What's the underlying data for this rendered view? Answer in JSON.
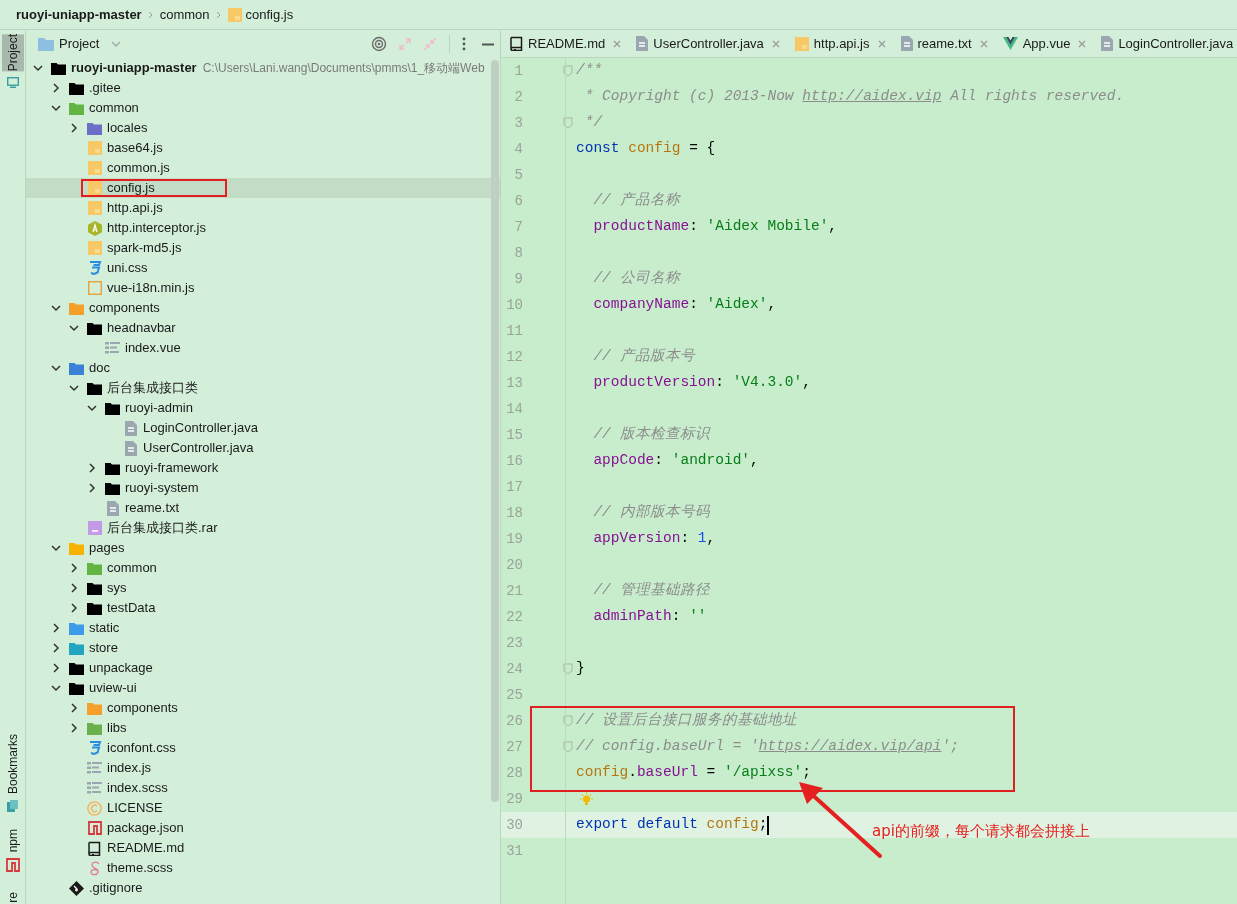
{
  "breadcrumb": [
    {
      "label": "ruoyi-uniapp-master",
      "kind": "project"
    },
    {
      "label": "common",
      "kind": "plain"
    },
    {
      "label": "config.js",
      "kind": "js"
    }
  ],
  "tool_strip": [
    {
      "label": "Project",
      "selected": true,
      "kind": "monitor"
    },
    {
      "label": "Bookmarks",
      "selected": false,
      "kind": "bookmark"
    },
    {
      "label": "npm",
      "selected": false,
      "kind": "npm"
    },
    {
      "label": "re",
      "selected": false,
      "kind": "plain"
    }
  ],
  "project_panel": {
    "title": "Project"
  },
  "tree": [
    {
      "label": "ruoyi-uniapp-master",
      "path": "C:\\Users\\Lani.wang\\Documents\\pmms\\1_移动端Web",
      "kind": "folder",
      "expanded": true,
      "selected": false,
      "children": [
        {
          "label": ".gitee",
          "kind": "folder",
          "expanded": false,
          "selected": false
        },
        {
          "label": "common",
          "kind": "folder-green",
          "expanded": true,
          "selected": false,
          "children": [
            {
              "label": "locales",
              "kind": "folder-purple",
              "expanded": false,
              "selected": false
            },
            {
              "label": "base64.js",
              "kind": "js",
              "selected": false
            },
            {
              "label": "common.js",
              "kind": "js",
              "selected": false
            },
            {
              "label": "config.js",
              "kind": "js",
              "selected": true,
              "marked": true
            },
            {
              "label": "http.api.js",
              "kind": "js",
              "selected": false
            },
            {
              "label": "http.interceptor.js",
              "kind": "angular",
              "selected": false
            },
            {
              "label": "spark-md5.js",
              "kind": "js",
              "selected": false
            },
            {
              "label": "uni.css",
              "kind": "css",
              "selected": false
            },
            {
              "label": "vue-i18n.min.js",
              "kind": "js-outline",
              "selected": false
            }
          ]
        },
        {
          "label": "components",
          "kind": "folder-orange",
          "expanded": true,
          "selected": false,
          "children": [
            {
              "label": "headnavbar",
              "kind": "folder",
              "expanded": true,
              "selected": false,
              "children": [
                {
                  "label": "index.vue",
                  "kind": "list",
                  "selected": false
                }
              ]
            }
          ]
        },
        {
          "label": "doc",
          "kind": "folder-blue",
          "expanded": true,
          "selected": false,
          "children": [
            {
              "label": "后台集成接口类",
              "kind": "folder",
              "expanded": true,
              "selected": false,
              "children": [
                {
                  "label": "ruoyi-admin",
                  "kind": "folder",
                  "expanded": true,
                  "selected": false,
                  "children": [
                    {
                      "label": "LoginController.java",
                      "kind": "text",
                      "selected": false
                    },
                    {
                      "label": "UserController.java",
                      "kind": "text",
                      "selected": false
                    }
                  ]
                },
                {
                  "label": "ruoyi-framework",
                  "kind": "folder",
                  "expanded": false,
                  "selected": false
                },
                {
                  "label": "ruoyi-system",
                  "kind": "folder",
                  "expanded": false,
                  "selected": false
                },
                {
                  "label": "reame.txt",
                  "kind": "text",
                  "selected": false
                }
              ]
            },
            {
              "label": "后台集成接口类.rar",
              "kind": "archive",
              "selected": false
            }
          ]
        },
        {
          "label": "pages",
          "kind": "folder-yellow",
          "expanded": true,
          "selected": false,
          "children": [
            {
              "label": "common",
              "kind": "folder-green",
              "expanded": false,
              "selected": false
            },
            {
              "label": "sys",
              "kind": "folder",
              "expanded": false,
              "selected": false
            },
            {
              "label": "testData",
              "kind": "folder",
              "expanded": false,
              "selected": false
            }
          ]
        },
        {
          "label": "static",
          "kind": "folder-web",
          "expanded": false,
          "selected": false
        },
        {
          "label": "store",
          "kind": "folder-teal",
          "expanded": false,
          "selected": false
        },
        {
          "label": "unpackage",
          "kind": "folder",
          "expanded": false,
          "selected": false
        },
        {
          "label": "uview-ui",
          "kind": "folder",
          "expanded": true,
          "selected": false,
          "children": [
            {
              "label": "components",
              "kind": "folder-orange",
              "expanded": false,
              "selected": false
            },
            {
              "label": "libs",
              "kind": "folder-libs",
              "expanded": false,
              "selected": false
            },
            {
              "label": "iconfont.css",
              "kind": "css",
              "selected": false
            },
            {
              "label": "index.js",
              "kind": "list",
              "selected": false
            },
            {
              "label": "index.scss",
              "kind": "list",
              "selected": false
            },
            {
              "label": "LICENSE",
              "kind": "license",
              "selected": false
            },
            {
              "label": "package.json",
              "kind": "npm",
              "selected": false
            },
            {
              "label": "README.md",
              "kind": "book",
              "selected": false
            },
            {
              "label": "theme.scss",
              "kind": "sass",
              "selected": false
            }
          ]
        },
        {
          "label": ".gitignore",
          "kind": "git",
          "selected": false
        }
      ]
    }
  ],
  "editor_tabs": [
    {
      "label": "README.md",
      "kind": "book",
      "closable": true
    },
    {
      "label": "UserController.java",
      "kind": "text",
      "closable": true
    },
    {
      "label": "http.api.js",
      "kind": "js",
      "closable": true
    },
    {
      "label": "reame.txt",
      "kind": "text",
      "closable": true
    },
    {
      "label": "App.vue",
      "kind": "vue",
      "closable": true
    },
    {
      "label": "LoginController.java",
      "kind": "text",
      "closable": false
    }
  ],
  "code_lines": [
    {
      "number": "1",
      "fold": true,
      "tokens": [
        {
          "kind": "comment",
          "text": "/**"
        }
      ]
    },
    {
      "number": "2",
      "tokens": [
        {
          "kind": "comment",
          "text": " * Copyright (c) 2013-Now "
        },
        {
          "kind": "link",
          "text": "http://aidex.vip"
        },
        {
          "kind": "comment",
          "text": " All rights reserved."
        }
      ]
    },
    {
      "number": "3",
      "fold": true,
      "tokens": [
        {
          "kind": "comment",
          "text": " */"
        }
      ]
    },
    {
      "number": "4",
      "tokens": [
        {
          "kind": "keyword",
          "text": "const"
        },
        {
          "kind": "variable",
          "text": " config"
        },
        {
          "kind": "plain",
          "text": " = {"
        }
      ]
    },
    {
      "number": "5"
    },
    {
      "number": "6",
      "tokens": [
        {
          "kind": "comment",
          "text": "  // 产品名称"
        }
      ]
    },
    {
      "number": "7",
      "tokens": [
        {
          "kind": "property",
          "text": "  productName"
        },
        {
          "kind": "plain",
          "text": ": "
        },
        {
          "kind": "string",
          "text": "'Aidex Mobile'"
        },
        {
          "kind": "plain",
          "text": ","
        }
      ]
    },
    {
      "number": "8"
    },
    {
      "number": "9",
      "tokens": [
        {
          "kind": "comment",
          "text": "  // 公司名称"
        }
      ]
    },
    {
      "number": "10",
      "tokens": [
        {
          "kind": "property",
          "text": "  companyName"
        },
        {
          "kind": "plain",
          "text": ": "
        },
        {
          "kind": "string",
          "text": "'Aidex'"
        },
        {
          "kind": "plain",
          "text": ","
        }
      ]
    },
    {
      "number": "11"
    },
    {
      "number": "12",
      "tokens": [
        {
          "kind": "comment",
          "text": "  // 产品版本号"
        }
      ]
    },
    {
      "number": "13",
      "tokens": [
        {
          "kind": "property",
          "text": "  productVersion"
        },
        {
          "kind": "plain",
          "text": ": "
        },
        {
          "kind": "string",
          "text": "'V4.3.0'"
        },
        {
          "kind": "plain",
          "text": ","
        }
      ]
    },
    {
      "number": "14"
    },
    {
      "number": "15",
      "tokens": [
        {
          "kind": "comment",
          "text": "  // 版本检查标识"
        }
      ]
    },
    {
      "number": "16",
      "tokens": [
        {
          "kind": "property",
          "text": "  appCode"
        },
        {
          "kind": "plain",
          "text": ": "
        },
        {
          "kind": "string",
          "text": "'android'"
        },
        {
          "kind": "plain",
          "text": ","
        }
      ]
    },
    {
      "number": "17"
    },
    {
      "number": "18",
      "tokens": [
        {
          "kind": "comment",
          "text": "  // 内部版本号码"
        }
      ]
    },
    {
      "number": "19",
      "tokens": [
        {
          "kind": "property",
          "text": "  appVersion"
        },
        {
          "kind": "plain",
          "text": ": "
        },
        {
          "kind": "number",
          "text": "1"
        },
        {
          "kind": "plain",
          "text": ","
        }
      ]
    },
    {
      "number": "20"
    },
    {
      "number": "21",
      "tokens": [
        {
          "kind": "comment",
          "text": "  // 管理基础路径"
        }
      ]
    },
    {
      "number": "22",
      "tokens": [
        {
          "kind": "property",
          "text": "  adminPath"
        },
        {
          "kind": "plain",
          "text": ": "
        },
        {
          "kind": "string",
          "text": "''"
        }
      ]
    },
    {
      "number": "23"
    },
    {
      "number": "24",
      "fold": true,
      "tokens": [
        {
          "kind": "plain",
          "text": "}"
        }
      ]
    },
    {
      "number": "25"
    },
    {
      "number": "26",
      "fold": true,
      "marked": true,
      "tokens": [
        {
          "kind": "comment",
          "text": "// 设置后台接口服务的基础地址"
        }
      ]
    },
    {
      "number": "27",
      "fold": true,
      "marked": true,
      "tokens": [
        {
          "kind": "comment",
          "text": "// config.baseUrl = '"
        },
        {
          "kind": "link",
          "text": "https://aidex.vip/api"
        },
        {
          "kind": "comment",
          "text": "';"
        }
      ]
    },
    {
      "number": "28",
      "marked": true,
      "tokens": [
        {
          "kind": "variable",
          "text": "config"
        },
        {
          "kind": "plain",
          "text": "."
        },
        {
          "kind": "property",
          "text": "baseUrl"
        },
        {
          "kind": "plain",
          "text": " = "
        },
        {
          "kind": "string",
          "text": "'/apixss'"
        },
        {
          "kind": "plain",
          "text": ";"
        }
      ]
    },
    {
      "number": "29",
      "bulb": true
    },
    {
      "number": "30",
      "current": true,
      "tokens": [
        {
          "kind": "keyword",
          "text": "export"
        },
        {
          "kind": "keyword",
          "text": " default"
        },
        {
          "kind": "variable",
          "text": " config"
        },
        {
          "kind": "plain",
          "text": ";"
        }
      ]
    },
    {
      "number": "31"
    }
  ],
  "annotation": {
    "text": "api的前缀，每个请求都会拼接上"
  }
}
